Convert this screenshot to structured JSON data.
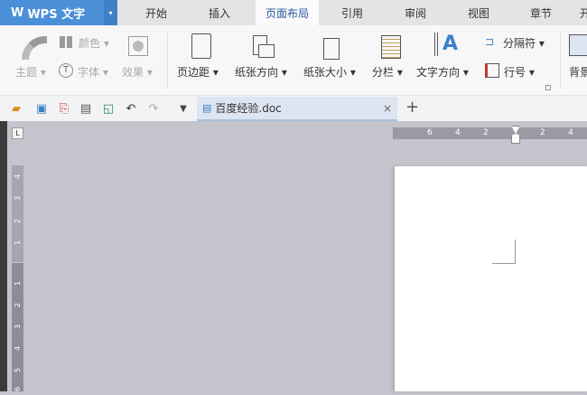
{
  "app": {
    "name": "WPS 文字",
    "dropdown": "▾"
  },
  "tabs": [
    {
      "label": "开始"
    },
    {
      "label": "插入"
    },
    {
      "label": "页面布局",
      "active": true
    },
    {
      "label": "引用"
    },
    {
      "label": "审阅"
    },
    {
      "label": "视图"
    },
    {
      "label": "章节"
    },
    {
      "label": "开"
    }
  ],
  "ribbon": {
    "theme": "主题 ▾",
    "color": "颜色 ▾",
    "font": "字体 ▾",
    "effect": "效果 ▾",
    "margins": "页边距 ▾",
    "orientation": "纸张方向 ▾",
    "size": "纸张大小 ▾",
    "columns": "分栏 ▾",
    "text_direction": "文字方向 ▾",
    "breaks": "分隔符 ▾",
    "line_numbers": "行号 ▾",
    "background": "背景"
  },
  "document_tab": {
    "title": "百度经验.doc",
    "close": "×",
    "new": "+"
  },
  "ruler": {
    "horizontal": [
      "6",
      "4",
      "2",
      "2",
      "4"
    ],
    "vertical_top": [
      "4",
      "3",
      "2",
      "1"
    ],
    "vertical_bottom": [
      "1",
      "2",
      "3",
      "4",
      "5",
      "6"
    ]
  }
}
